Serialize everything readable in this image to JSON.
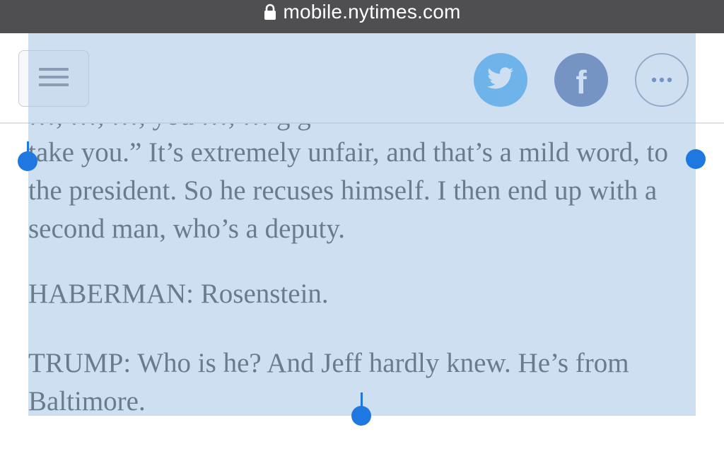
{
  "browser": {
    "url": "mobile.nytimes.com"
  },
  "toolbar": {
    "menu_icon": "hamburger-icon",
    "share_buttons": [
      {
        "name": "twitter",
        "icon": "twitter-bird-icon",
        "color": "#2ca1f2"
      },
      {
        "name": "facebook",
        "icon": "facebook-f-icon",
        "label": "f",
        "color": "#3b5a9b"
      },
      {
        "name": "more",
        "icon": "ellipsis-icon",
        "color": "#7b8fa8"
      }
    ]
  },
  "article": {
    "cut_off_line": "…, …, …, you …, … g g",
    "paragraphs": [
      "take you.” It’s extremely unfair, and that’s a mild word, to the president. So he recuses himself. I then end up with a second man, who’s a deputy.",
      "HABERMAN: Rosenstein.",
      "TRUMP: Who is he? And Jeff hardly knew. He’s from Baltimore."
    ]
  },
  "selection": {
    "color": "#a5c4e6",
    "handle_color": "#1f78e0"
  }
}
